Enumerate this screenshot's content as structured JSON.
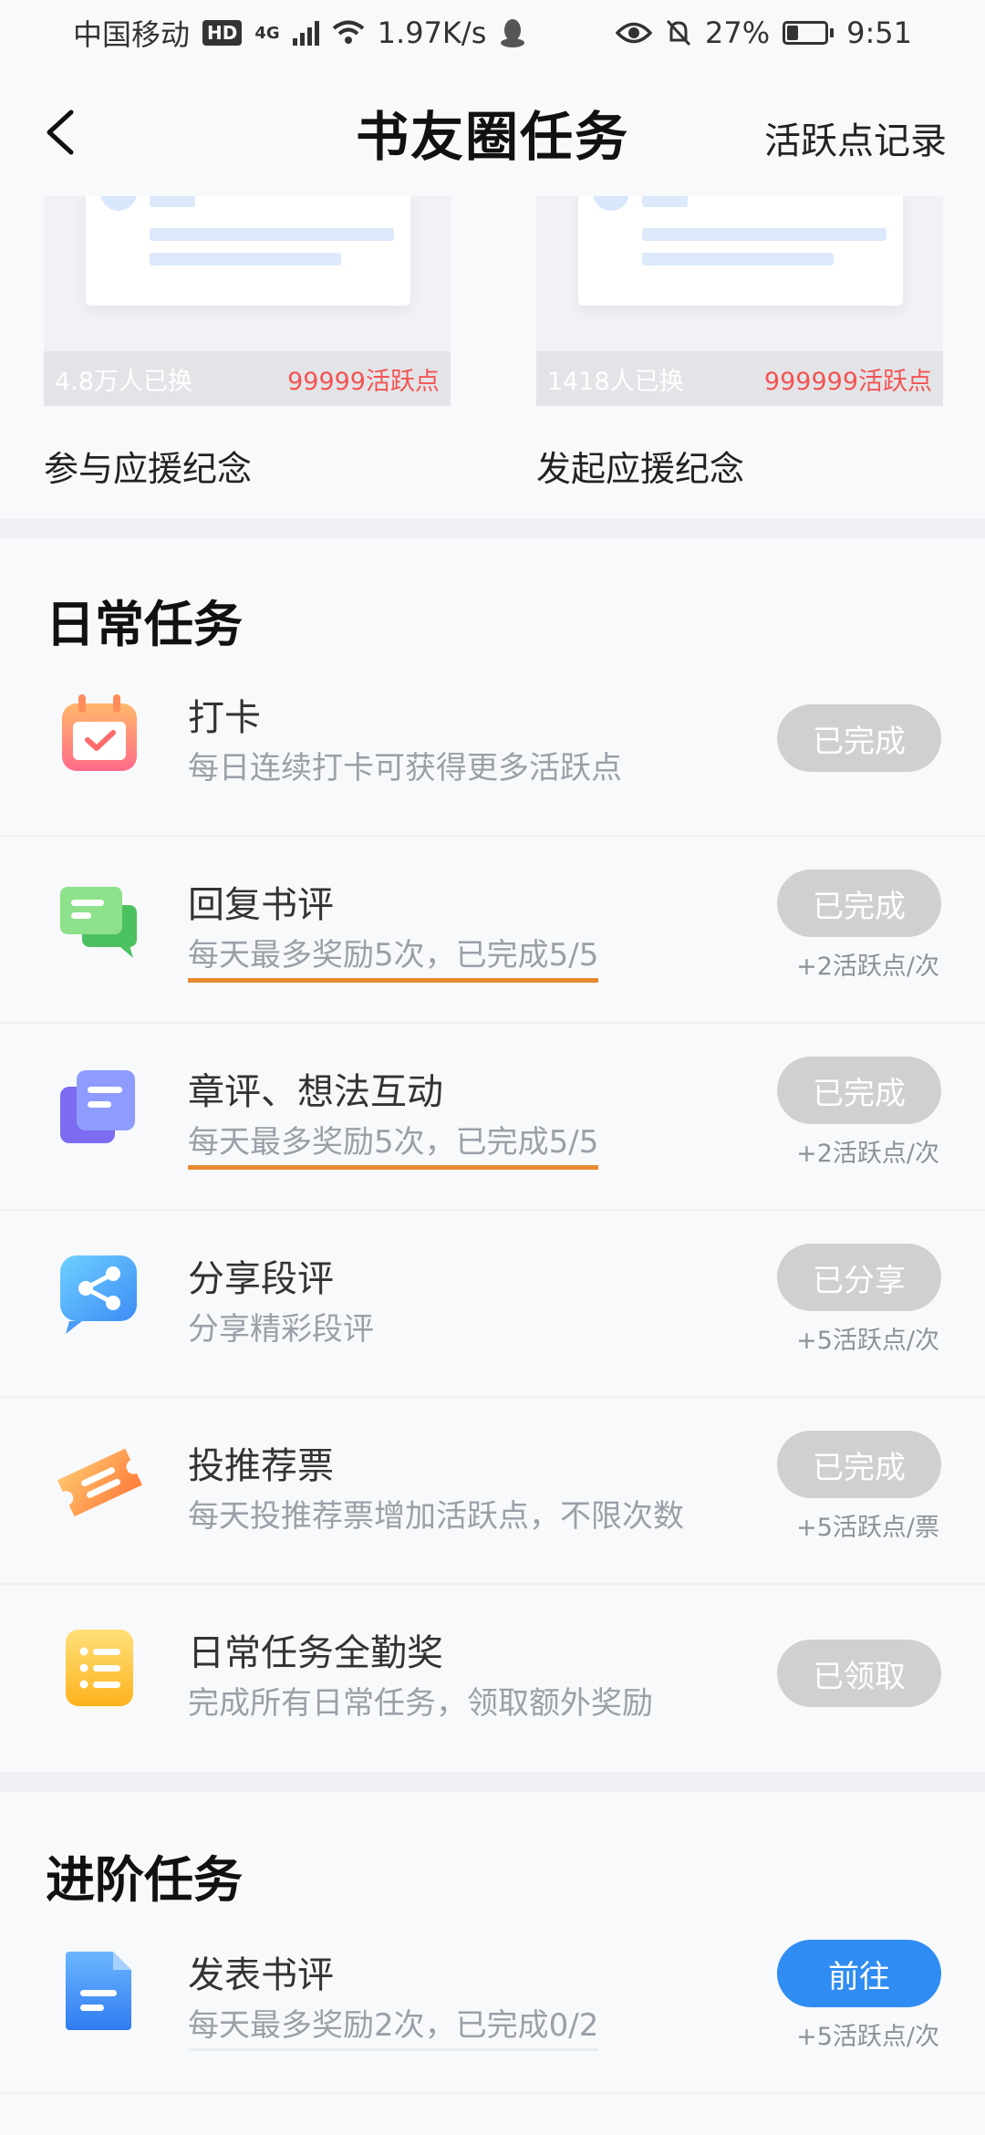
{
  "status_bar": {
    "carrier": "中国移动",
    "hd": "HD",
    "network": "4G",
    "speed": "1.97K/s",
    "battery": "27%",
    "time": "9:51"
  },
  "header": {
    "title": "书友圈任务",
    "record_link": "活跃点记录"
  },
  "rewards": [
    {
      "exchanged": "4.8万人已换",
      "cost": "99999活跃点",
      "title": "参与应援纪念"
    },
    {
      "exchanged": "1418人已换",
      "cost": "999999活跃点",
      "title": "发起应援纪念"
    }
  ],
  "daily": {
    "title": "日常任务",
    "tasks": [
      {
        "title": "打卡",
        "desc": "每日连续打卡可获得更多活跃点",
        "button": "已完成",
        "points": "",
        "icon": "calendar-check-icon"
      },
      {
        "title": "回复书评",
        "desc": "每天最多奖励5次，已完成5/5",
        "button": "已完成",
        "points": "+2活跃点/次",
        "icon": "chat-bubbles-icon"
      },
      {
        "title": "章评、想法互动",
        "desc": "每天最多奖励5次，已完成5/5",
        "button": "已完成",
        "points": "+2活跃点/次",
        "icon": "notes-stack-icon"
      },
      {
        "title": "分享段评",
        "desc": "分享精彩段评",
        "button": "已分享",
        "points": "+5活跃点/次",
        "icon": "share-icon"
      },
      {
        "title": "投推荐票",
        "desc": "每天投推荐票增加活跃点，不限次数",
        "button": "已完成",
        "points": "+5活跃点/票",
        "icon": "ticket-icon"
      },
      {
        "title": "日常任务全勤奖",
        "desc": "完成所有日常任务，领取额外奖励",
        "button": "已领取",
        "points": "",
        "icon": "checklist-icon"
      }
    ]
  },
  "advanced": {
    "title": "进阶任务",
    "tasks": [
      {
        "title": "发表书评",
        "desc": "每天最多奖励2次，已完成0/2",
        "button": "前往",
        "points": "+5活跃点/次",
        "icon": "document-icon"
      }
    ]
  },
  "colors": {
    "primary": "#2f8cf2",
    "disabled": "#cfd0d2",
    "cost": "#f35353",
    "underline": "#e8892f"
  }
}
